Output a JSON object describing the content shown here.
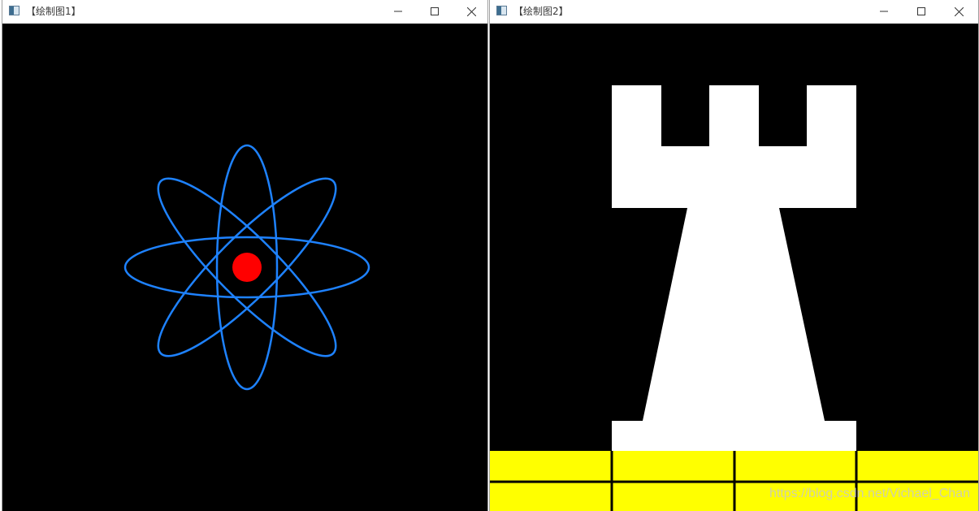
{
  "windows": [
    {
      "title": "【绘制图1】",
      "controls": [
        "minimize",
        "maximize",
        "close"
      ]
    },
    {
      "title": "【绘制图2】",
      "controls": [
        "minimize",
        "maximize",
        "close"
      ]
    }
  ],
  "colors": {
    "canvas_background": "#000000",
    "orbit": "#1e82ff",
    "nucleus": "#ff0000",
    "rook": "#ffffff",
    "floor_tiles": "#ffff00",
    "floor_lines": "#000000"
  },
  "icons": {
    "app": "opencv-window-icon",
    "minimize": "minimize-icon",
    "maximize": "maximize-icon",
    "close": "close-icon"
  },
  "drawing1": {
    "description_shapes": [
      "orbit-ellipse x4",
      "nucleus-circle"
    ]
  },
  "drawing2": {
    "description_shapes": [
      "rook-polygon",
      "floor-tiles"
    ]
  },
  "watermark": "https://blog.csdn.net/Vichael_Chan"
}
